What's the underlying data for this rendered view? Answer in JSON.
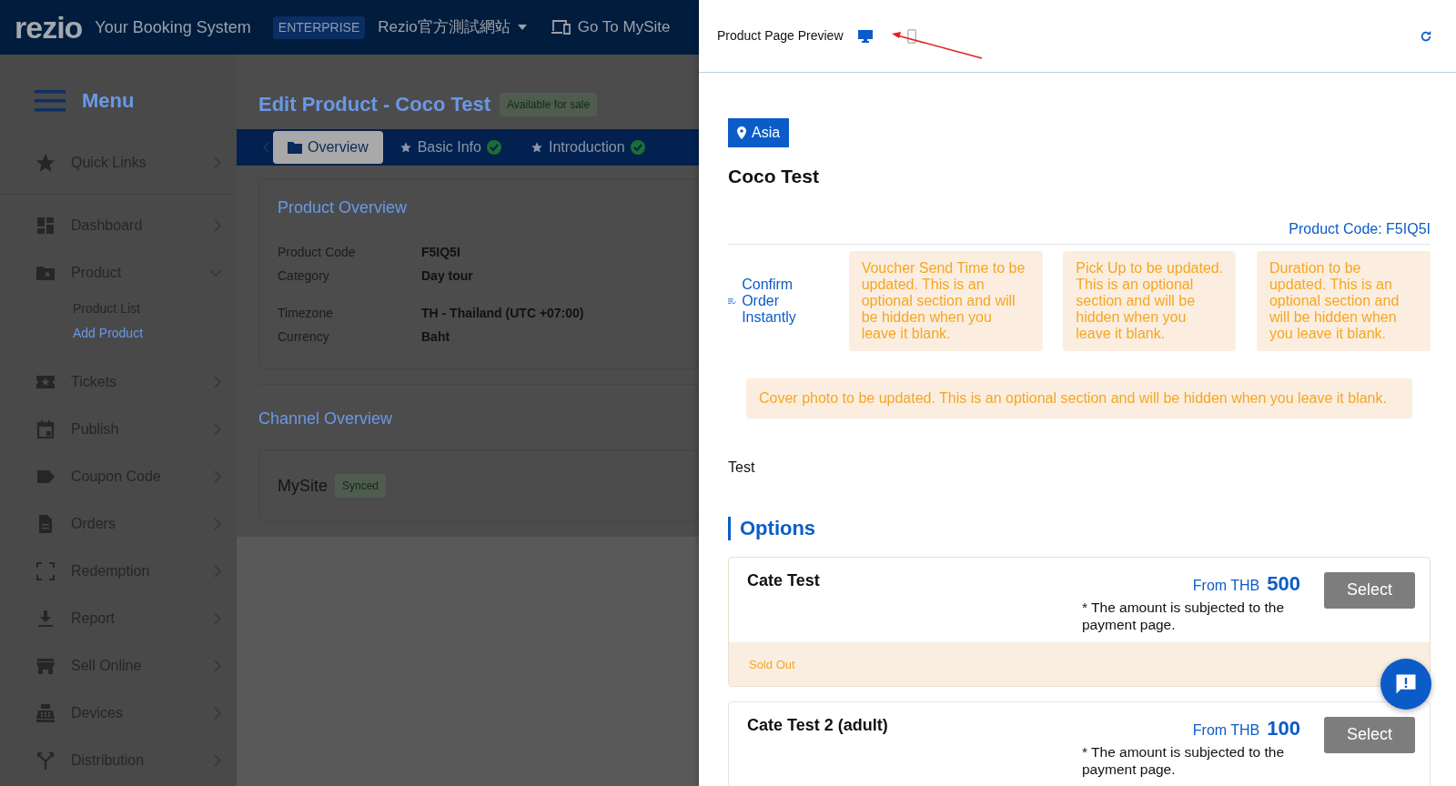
{
  "header": {
    "logo": "rezio",
    "tagline": "Your Booking System",
    "plan": "ENTERPRISE",
    "site": "Rezio官方測試網站",
    "go_to": "Go To MySite"
  },
  "sidebar": {
    "title": "Menu",
    "items": [
      {
        "kind": "star",
        "label": "Quick Links",
        "expanded": false
      },
      {
        "kind": "dashboard",
        "label": "Dashboard",
        "expanded": false
      },
      {
        "kind": "product",
        "label": "Product",
        "expanded": true,
        "children": [
          {
            "label": "Product List",
            "selected": false
          },
          {
            "label": "Add Product",
            "selected": true
          }
        ]
      },
      {
        "kind": "ticket",
        "label": "Tickets",
        "expanded": false
      },
      {
        "kind": "calendar",
        "label": "Publish",
        "expanded": false
      },
      {
        "kind": "tag",
        "label": "Coupon Code",
        "expanded": false
      },
      {
        "kind": "document",
        "label": "Orders",
        "expanded": false
      },
      {
        "kind": "scan",
        "label": "Redemption",
        "expanded": false
      },
      {
        "kind": "download",
        "label": "Report",
        "expanded": false
      },
      {
        "kind": "store",
        "label": "Sell Online",
        "expanded": false
      },
      {
        "kind": "register",
        "label": "Devices",
        "expanded": false
      },
      {
        "kind": "fork",
        "label": "Distribution",
        "expanded": false
      }
    ]
  },
  "page": {
    "title": "Edit Product - Coco Test",
    "status": "Available for sale",
    "tabs": [
      {
        "label": "Overview",
        "selected": true,
        "done": false
      },
      {
        "label": "Basic Info",
        "selected": false,
        "done": true
      },
      {
        "label": "Introduction",
        "selected": false,
        "done": true
      }
    ],
    "product_overview": {
      "title": "Product Overview",
      "groups": [
        [
          {
            "label": "Product Code",
            "value": "F5IQ5I"
          },
          {
            "label": "Category",
            "value": "Day tour"
          }
        ],
        [
          {
            "label": "Timezone",
            "value": "TH - Thailand (UTC +07:00)"
          },
          {
            "label": "Currency",
            "value": "Baht"
          }
        ]
      ]
    },
    "channel_overview": {
      "title": "Channel Overview",
      "channels": [
        {
          "name": "MySite",
          "status": "Synced"
        }
      ]
    }
  },
  "preview": {
    "title": "Product Page Preview",
    "view_modes": [
      {
        "kind": "desktop",
        "selected": true
      },
      {
        "kind": "mobile",
        "selected": false
      }
    ],
    "location": "Asia",
    "product_name": "Coco Test",
    "product_code": "Product Code: F5IQ5I",
    "feature": "Confirm Order Instantly",
    "notes": [
      "Voucher Send Time to be updated. This is an optional section and will be hidden when you leave it blank.",
      "Pick Up to be updated. This is an optional section and will be hidden when you leave it blank.",
      "Duration to be updated. This is an optional section and will be hidden when you leave it blank."
    ],
    "cover_note": "Cover photo to be updated. This is an optional section and will be hidden when you leave it blank.",
    "description": "Test",
    "options_title": "Options",
    "options": [
      {
        "name": "Cate Test",
        "price_prefix": "From THB",
        "price": "500",
        "note": "* The amount is subjected to the payment page.",
        "button": "Select",
        "sold_out": true,
        "sold_out_label": "Sold Out"
      },
      {
        "name": "Cate Test 2 (adult)",
        "price_prefix": "From THB",
        "price": "100",
        "note": "* The amount is subjected to the payment page.",
        "button": "Select",
        "sold_out": false
      }
    ]
  }
}
